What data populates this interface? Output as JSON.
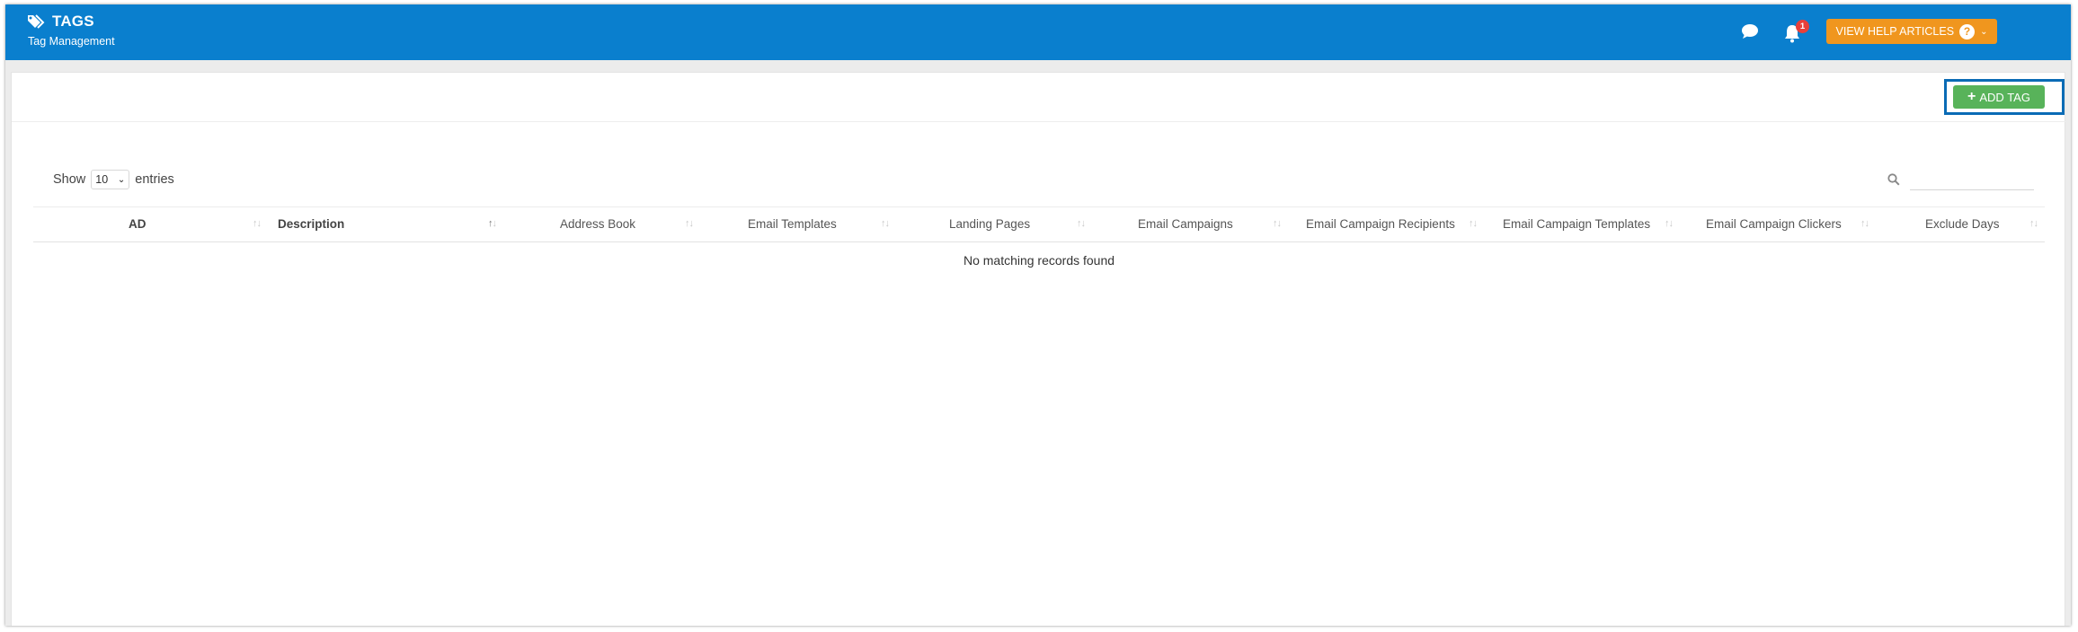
{
  "header": {
    "title": "TAGS",
    "subtitle": "Tag Management",
    "notification_count": "1",
    "help_label": "VIEW HELP ARTICLES",
    "help_icon_text": "?"
  },
  "toolbar": {
    "add_label": "ADD TAG"
  },
  "length": {
    "prefix": "Show",
    "value": "10",
    "suffix": "entries"
  },
  "search": {
    "placeholder": "",
    "value": ""
  },
  "table": {
    "columns": [
      "AD",
      "Description",
      "Address Book",
      "Email Templates",
      "Landing Pages",
      "Email Campaigns",
      "Email Campaign Recipients",
      "Email Campaign Templates",
      "Email Campaign Clickers",
      "Exclude Days"
    ],
    "empty_text": "No matching records found"
  },
  "colors": {
    "header_bg": "#0a7fce",
    "help_button": "#f0961e",
    "add_button": "#58b35a",
    "badge": "#e8403a"
  },
  "icons": {
    "title": "tags-icon",
    "chat": "chat-bubble-icon",
    "bell": "bell-icon",
    "search": "search-icon"
  }
}
